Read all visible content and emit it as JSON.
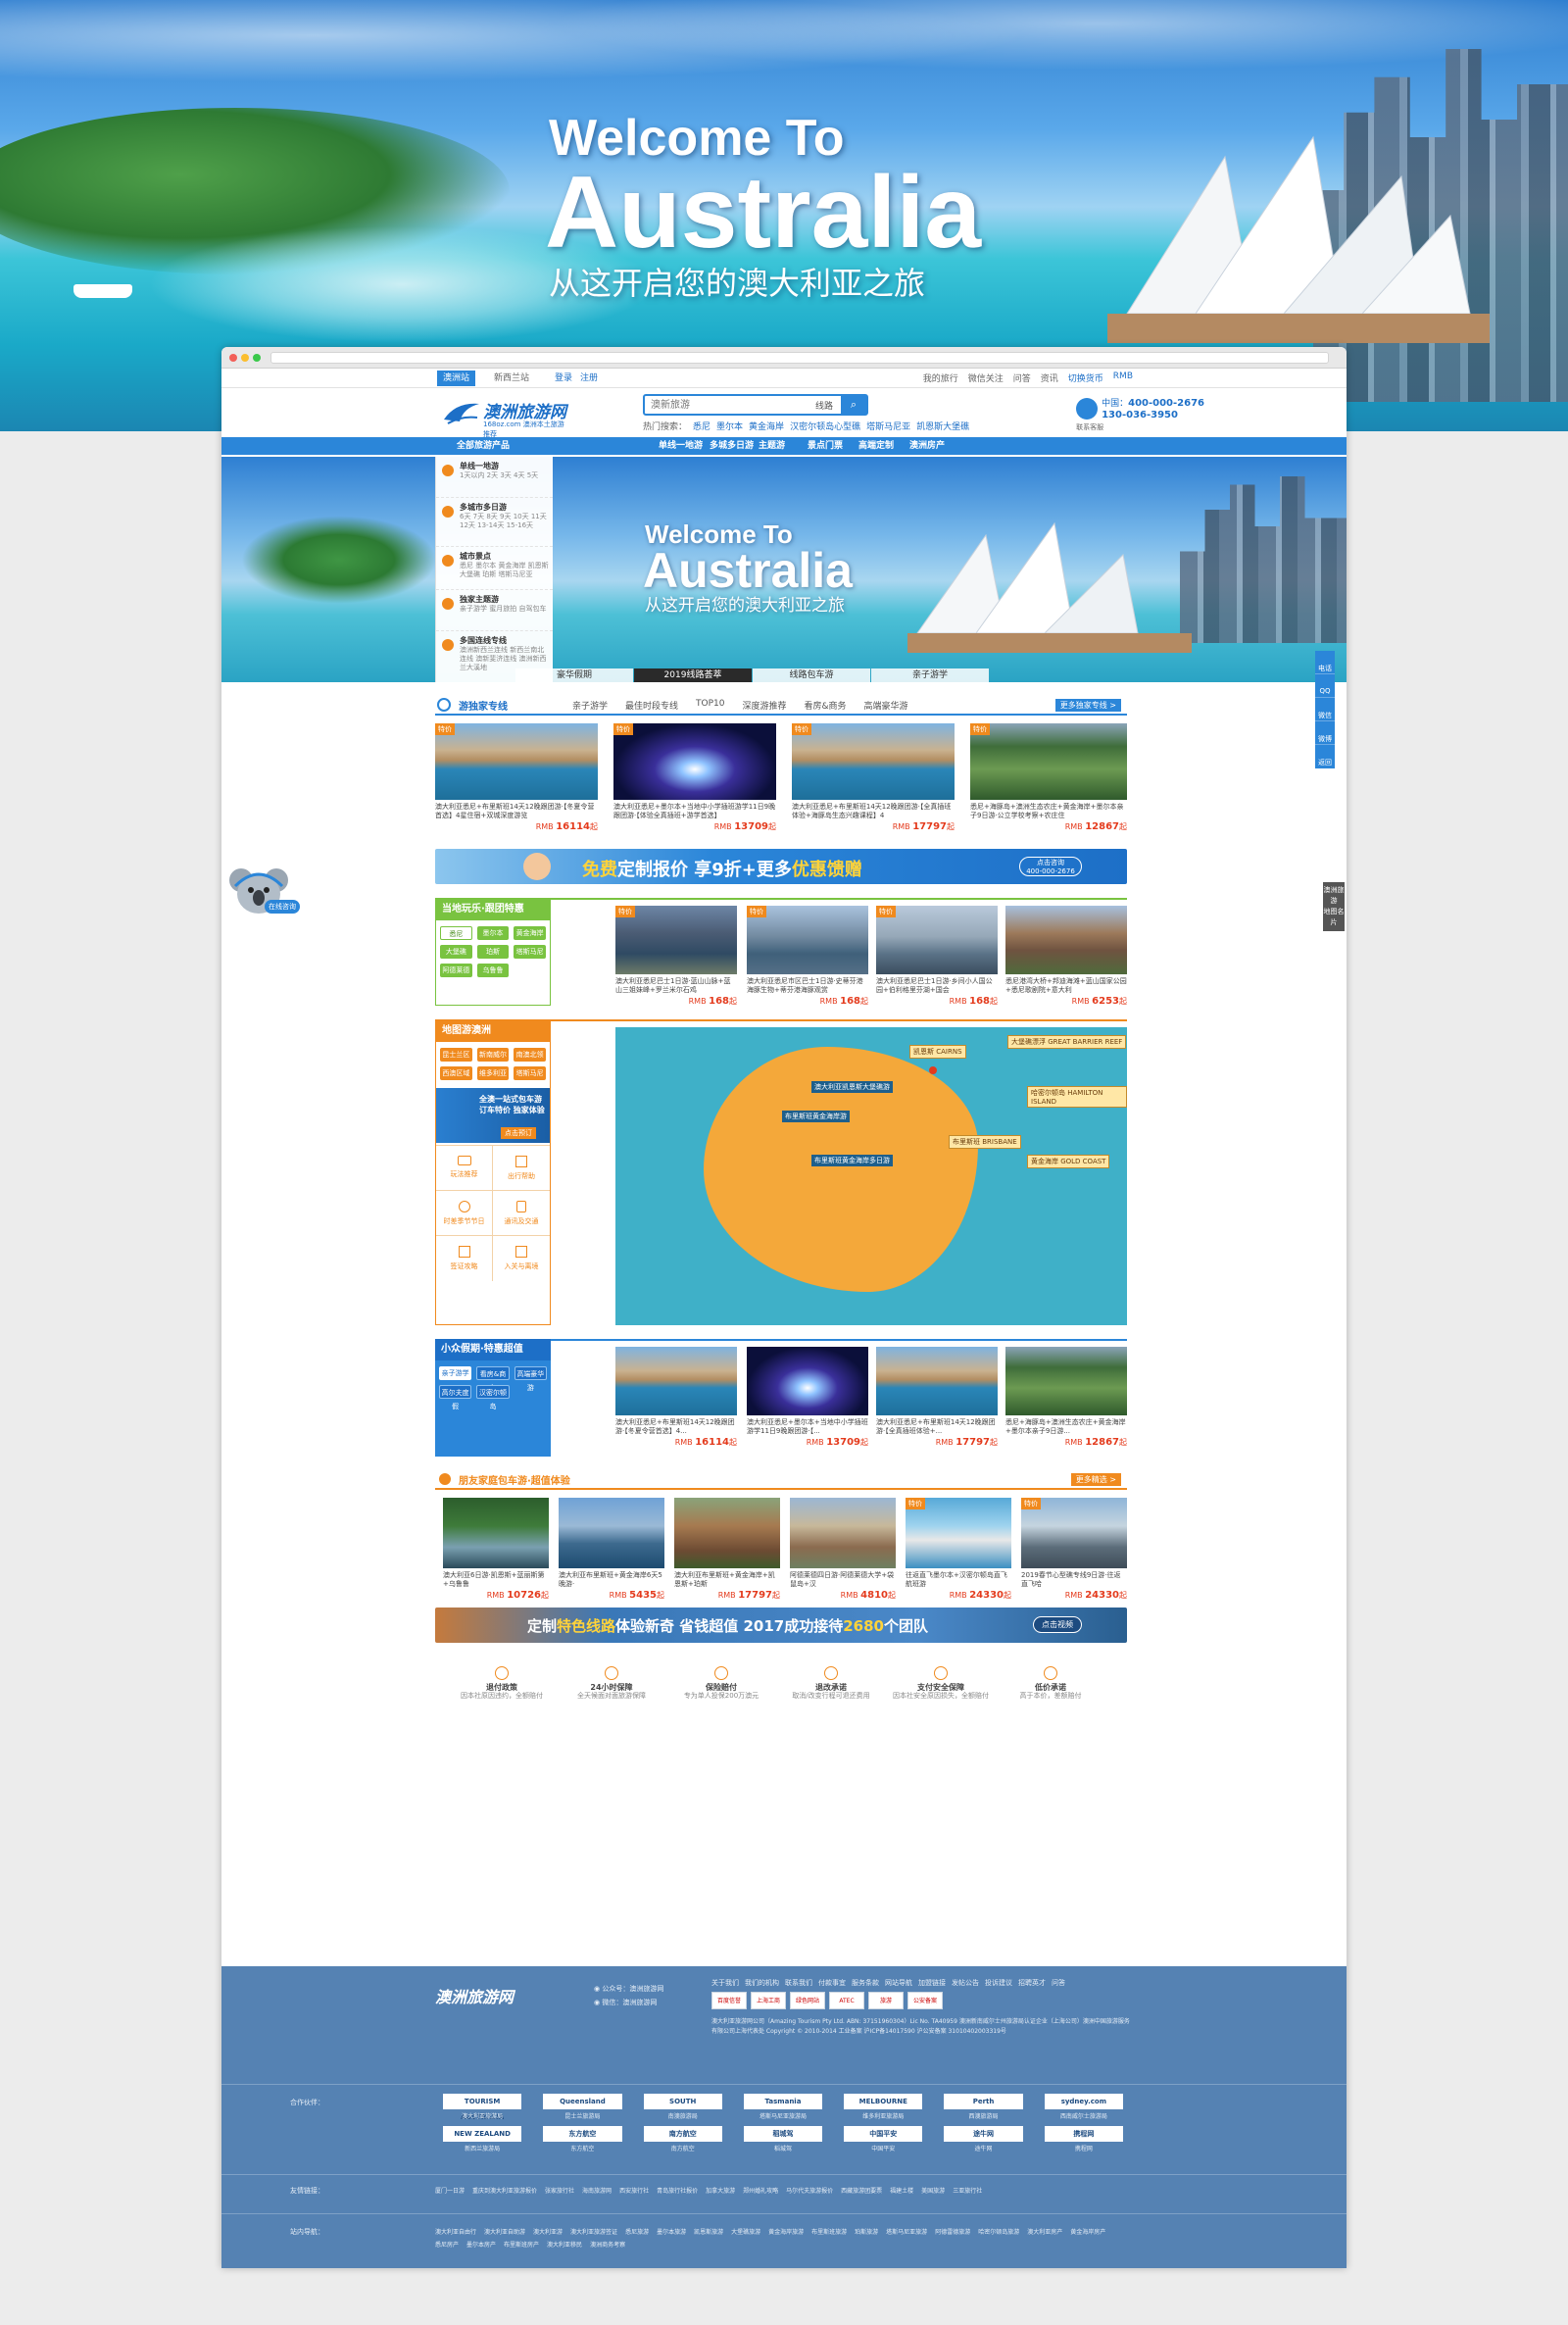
{
  "hero": {
    "line1": "Welcome To",
    "line2": "Australia",
    "line3": "从这开启您的澳大利亚之旅"
  },
  "topbar": {
    "tabs": [
      "澳洲站",
      "新西兰站"
    ],
    "login": "登录",
    "register": "注册",
    "links": [
      "我的旅行",
      "微信关注",
      "问答",
      "资讯",
      "切换货币",
      "RMB"
    ]
  },
  "header": {
    "logo_name": "澳洲旅游网",
    "logo_sub": "168oz.com 澳洲本土旅游推荐",
    "search_placeholder": "澳新旅游",
    "search_category": "线路",
    "search_button": "⌕",
    "hot_label": "热门搜索：",
    "hot_words": [
      "悉尼",
      "墨尔本",
      "黄金海岸",
      "汉密尔顿岛心型礁",
      "塔斯马尼亚",
      "凯恩斯大堡礁"
    ],
    "contact_label": "中国：",
    "phone1": "400-000-2676",
    "phone2": "130-036-3950",
    "service": "联系客服"
  },
  "nav": {
    "all_products": "全部旅游产品",
    "items": [
      "单线一地游",
      "多城多日游",
      "主题游",
      "景点门票",
      "高端定制",
      "澳洲房产"
    ]
  },
  "banner": {
    "line1": "Welcome To",
    "line2": "Australia",
    "line3": "从这开启您的澳大利亚之旅",
    "tabs": [
      "豪华假期",
      "2019线路荟萃",
      "线路包车游",
      "亲子游学"
    ]
  },
  "sidemenu": [
    {
      "title": "单线一地游",
      "sub": "1天以内  2天  3天  4天  5天"
    },
    {
      "title": "多城市多日游",
      "sub": "6天  7天  8天  9天  10天  11天  12天  13-14天  15-16天"
    },
    {
      "title": "城市景点",
      "sub": "悉尼  墨尔本  黄金海岸  凯恩斯大堡礁  珀斯  塔斯马尼亚"
    },
    {
      "title": "独家主题游",
      "sub": "亲子游学  蜜月旅拍  自驾包车"
    },
    {
      "title": "多国连线专线",
      "sub": "澳洲新西兰连线  新西兰南北连线  澳新斐济连线  澳洲新西兰大溪地"
    }
  ],
  "floatbar": [
    "电话",
    "QQ",
    "微信",
    "微博",
    "返回"
  ],
  "koala_label": "在线咨询",
  "sidefloat": [
    "澳洲旅游",
    "地图名片"
  ],
  "section1": {
    "title": "游独家专线",
    "tabs": [
      "亲子游学",
      "最佳时段专线",
      "TOP10",
      "深度游推荐",
      "看房&商务",
      "高端豪华游"
    ],
    "more": "更多独家专线 >",
    "cards": [
      {
        "tag": "特价",
        "desc": "澳大利亚悉尼+布里斯班14天12晚跟团游·【冬夏令营首选】4星住宿+双城深度游览",
        "currency": "RMB",
        "price": "16114",
        "unit": "起"
      },
      {
        "tag": "特价",
        "desc": "澳大利亚悉尼+墨尔本+当地中小学插班游学11日9晚跟团游·【体验全真插班+游学首选】",
        "currency": "RMB",
        "price": "13709",
        "unit": "起"
      },
      {
        "tag": "特价",
        "desc": "澳大利亚悉尼+布里斯班14天12晚跟团游·【全真插班体验+海豚岛生态兴趣课程】4",
        "currency": "RMB",
        "price": "17797",
        "unit": "起"
      },
      {
        "tag": "特价",
        "desc": "悉尼+海豚岛+澳洲生态农庄+黄金海岸+墨尔本亲子9日游·公立学校考察+农庄住",
        "currency": "RMB",
        "price": "12867",
        "unit": "起"
      }
    ]
  },
  "promo1": {
    "text_a": "免费",
    "text_b": "定制报价  享9折+更多",
    "text_c": "优惠馈赠",
    "btn_line1": "点击咨询",
    "btn_line2": "400-000-2676"
  },
  "section2": {
    "title": "当地玩乐·跟团特惠",
    "chips": [
      "悉尼",
      "墨尔本",
      "黄金海岸",
      "大堡礁",
      "珀斯",
      "塔斯马尼亚",
      "阿德莱德",
      "乌鲁鲁"
    ],
    "cards": [
      {
        "tag": "特价",
        "desc": "澳大利亚悉尼巴士1日游·蓝山山脉+蓝山三姐妹峰+罗兰米尔石鸡",
        "currency": "RMB",
        "price": "168",
        "unit": "起"
      },
      {
        "tag": "特价",
        "desc": "澳大利亚悉尼市区巴士1日游·史蒂芬港海豚生物+蒂芬港海豚观赏",
        "currency": "RMB",
        "price": "168",
        "unit": "起"
      },
      {
        "tag": "特价",
        "desc": "澳大利亚悉尼巴士1日游·乡间小人国公园+伯利格里芬湖+国会",
        "currency": "RMB",
        "price": "168",
        "unit": "起"
      },
      {
        "tag": "",
        "desc": "悉尼港湾大桥+邦迪海滩+蓝山国家公园+悉尼歌剧院+意大利",
        "currency": "RMB",
        "price": "6253",
        "unit": "起"
      }
    ]
  },
  "section3": {
    "title": "地图游澳洲",
    "chips": [
      "昆士兰区域",
      "新南威尔士",
      "南澳北领地",
      "西澳区域",
      "维多利亚",
      "塔斯马尼亚"
    ],
    "car_banner": "全澳一站式包车游 订车特价 独家体验",
    "car_btn": "点击预订",
    "grid": [
      "玩法推荐",
      "出行帮助",
      "时差季节节日",
      "通讯及交通",
      "签证攻略",
      "入关与离境"
    ],
    "map_labels": [
      "大堡礁漂浮 GREAT BARRIER REEF",
      "凯恩斯 CAIRNS",
      "哈密尔顿岛 HAMILTON ISLAND",
      "布里斯班 BRISBANE",
      "黄金海岸 GOLD COAST"
    ],
    "map_routes": [
      "澳大利亚凯恩斯大堡礁游",
      "布里斯班黄金海岸游",
      "布里斯班黄金海岸多日游"
    ]
  },
  "section4": {
    "title": "小众假期·特惠超值",
    "chips": [
      "亲子游学",
      "看房&商务",
      "高端豪华游",
      "高尔夫度假",
      "汉密尔顿岛"
    ],
    "cards": [
      {
        "tag": "",
        "desc": "澳大利亚悉尼+布里斯班14天12晚跟团游·【冬夏令营首选】4...",
        "currency": "RMB",
        "price": "16114",
        "unit": "起"
      },
      {
        "tag": "",
        "desc": "澳大利亚悉尼+墨尔本+当地中小学插班游学11日9晚跟团游·【...",
        "currency": "RMB",
        "price": "13709",
        "unit": "起"
      },
      {
        "tag": "",
        "desc": "澳大利亚悉尼+布里斯班14天12晚跟团游·【全真插班体验+...",
        "currency": "RMB",
        "price": "17797",
        "unit": "起"
      },
      {
        "tag": "",
        "desc": "悉尼+海豚岛+澳洲生态农庄+黄金海岸+墨尔本亲子9日游...",
        "currency": "RMB",
        "price": "12867",
        "unit": "起"
      }
    ]
  },
  "section5": {
    "title": "朋友家庭包车游·超值体验",
    "more": "更多精选 >",
    "cards": [
      {
        "tag": "",
        "desc": "澳大利亚6日游·凯恩斯+蓝丽斯第+乌鲁鲁",
        "currency": "RMB",
        "price": "10726",
        "unit": "起"
      },
      {
        "tag": "",
        "desc": "澳大利亚布里斯班+黄金海岸6天5晚游·",
        "currency": "RMB",
        "price": "5435",
        "unit": "起"
      },
      {
        "tag": "",
        "desc": "澳大利亚布里斯班+黄金海岸+凯恩斯+珀斯",
        "currency": "RMB",
        "price": "17797",
        "unit": "起"
      },
      {
        "tag": "",
        "desc": "阿德莱德四日游·阿德莱德大学+袋鼠岛+汉",
        "currency": "RMB",
        "price": "4810",
        "unit": "起"
      },
      {
        "tag": "特价",
        "desc": "往返直飞墨尔本+汉密尔顿岛直飞航班游",
        "currency": "RMB",
        "price": "24330",
        "unit": "起"
      },
      {
        "tag": "特价",
        "desc": "2019春节心型礁专线9日游·往返直飞哈",
        "currency": "RMB",
        "price": "24330",
        "unit": "起"
      }
    ]
  },
  "promo2": {
    "text_a": "定制",
    "text_b": "特色线路",
    "text_c": "体验新奇 省钱超值  2017成功接待",
    "text_d": "2680",
    "text_e": "个团队",
    "btn": "点击视频"
  },
  "features": [
    {
      "title": "退付政策",
      "sub": "因本社原因违约，全额赔付"
    },
    {
      "title": "24小时保障",
      "sub": "全天候面对面旅游保障"
    },
    {
      "title": "保险赔付",
      "sub": "专为单人投保200万澳元"
    },
    {
      "title": "退改承诺",
      "sub": "取消/改变行程可退还费用"
    },
    {
      "title": "支付安全保障",
      "sub": "因本社安全原因损失，全额赔付"
    },
    {
      "title": "低价承诺",
      "sub": "高于本价，差额赔付"
    }
  ],
  "footer": {
    "logo": "澳洲旅游网",
    "qq": "公众号：澳洲旅游网",
    "wechat": "微信：澳洲旅游网",
    "links": [
      "关于我们",
      "我们的机构",
      "联系我们",
      "付款事宜",
      "服务条款",
      "网站导航",
      "加盟链接",
      "发帖公告",
      "投诉建议",
      "招聘英才",
      "问答"
    ],
    "certs": [
      "百度信誉",
      "上海工商",
      "绿色网站",
      "ATEC",
      "旅游",
      "公安备案"
    ],
    "info": "澳大利亚旅游网公司（Amazing Tourism Pty Ltd. ABN: 37151960304）Lic No. TA40959 澳洲新南威尔士州旅游局认证企业（上海公司）澳洲中国旅游服务有限公司上海代表处 Copyright © 2010-2014 工业备案 沪ICP备14017590 沪公安备案 31010402003319号",
    "partners_label": "合作伙伴：",
    "partners": [
      {
        "logo": "TOURISM AUSTRALIA",
        "name": "澳大利亚旅游局"
      },
      {
        "logo": "Queensland",
        "name": "昆士兰旅游局"
      },
      {
        "logo": "SOUTH",
        "name": "南澳旅游局"
      },
      {
        "logo": "Tasmania",
        "name": "塔斯马尼亚旅游局"
      },
      {
        "logo": "MELBOURNE",
        "name": "维多利亚旅游局"
      },
      {
        "logo": "Perth",
        "name": "西澳旅游局"
      },
      {
        "logo": "sydney.com",
        "name": "西南威尔士旅游局"
      },
      {
        "logo": "NEW ZEALAND",
        "name": "新西兰旅游局"
      },
      {
        "logo": "东方航空",
        "name": "东方航空"
      },
      {
        "logo": "南方航空",
        "name": "南方航空"
      },
      {
        "logo": "稻城驾",
        "name": "稻城驾"
      },
      {
        "logo": "中国平安",
        "name": "中国平安"
      },
      {
        "logo": "途牛网",
        "name": "途牛网"
      },
      {
        "logo": "携程网",
        "name": "携程网"
      }
    ],
    "friends_label": "友情链接：",
    "friends": [
      "厦门一日游",
      "重庆到澳大利亚旅游报价",
      "张家旅行社",
      "海南旅游网",
      "西安旅行社",
      "青岛旅行社报价",
      "加拿大旅游",
      "郑州婚礼攻略",
      "马尔代夫旅游报价",
      "西藏旅游团要票",
      "福建土楼",
      "美国旅游",
      "三亚旅行社"
    ],
    "nav_label": "站内导航：",
    "nav": [
      "澳大利亚自由行",
      "澳大利亚自助游",
      "澳大利亚游",
      "澳大利亚旅游签证",
      "悉尼旅游",
      "墨尔本旅游",
      "凯恩斯旅游",
      "大堡礁旅游",
      "黄金海岸旅游",
      "布里斯班旅游",
      "珀斯旅游",
      "塔斯马尼亚旅游",
      "阿德雷德旅游",
      "哈密尔顿岛旅游",
      "澳大利亚房产",
      "黄金海岸房产",
      "悉尼房产",
      "墨尔本房产",
      "布里斯班房产",
      "澳大利亚移民",
      "澳洲商务考察"
    ]
  }
}
